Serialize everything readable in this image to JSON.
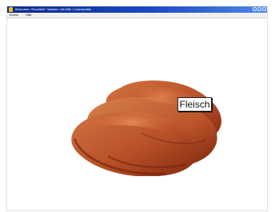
{
  "window": {
    "title": "Bildordner / Einzelbild / Tastatur / mit Hilfe / Lebensmittel",
    "menu": {
      "items": [
        {
          "label": "Ebene"
        },
        {
          "label": "Hilfe"
        }
      ]
    },
    "icons": {
      "app_icon": "app-icon",
      "minimize_icon": "minimize-icon",
      "maximize_icon": "maximize-icon",
      "close_icon": "close-icon"
    },
    "colors": {
      "titlebar_start": "#0b2a8c",
      "titlebar_mid": "#1b49c4",
      "titlebar_end": "#4f87e6",
      "meat_dark": "#8c2d12",
      "meat_mid": "#c4562b",
      "meat_light": "#e07a45"
    }
  },
  "main": {
    "word_label": "Fleisch"
  }
}
